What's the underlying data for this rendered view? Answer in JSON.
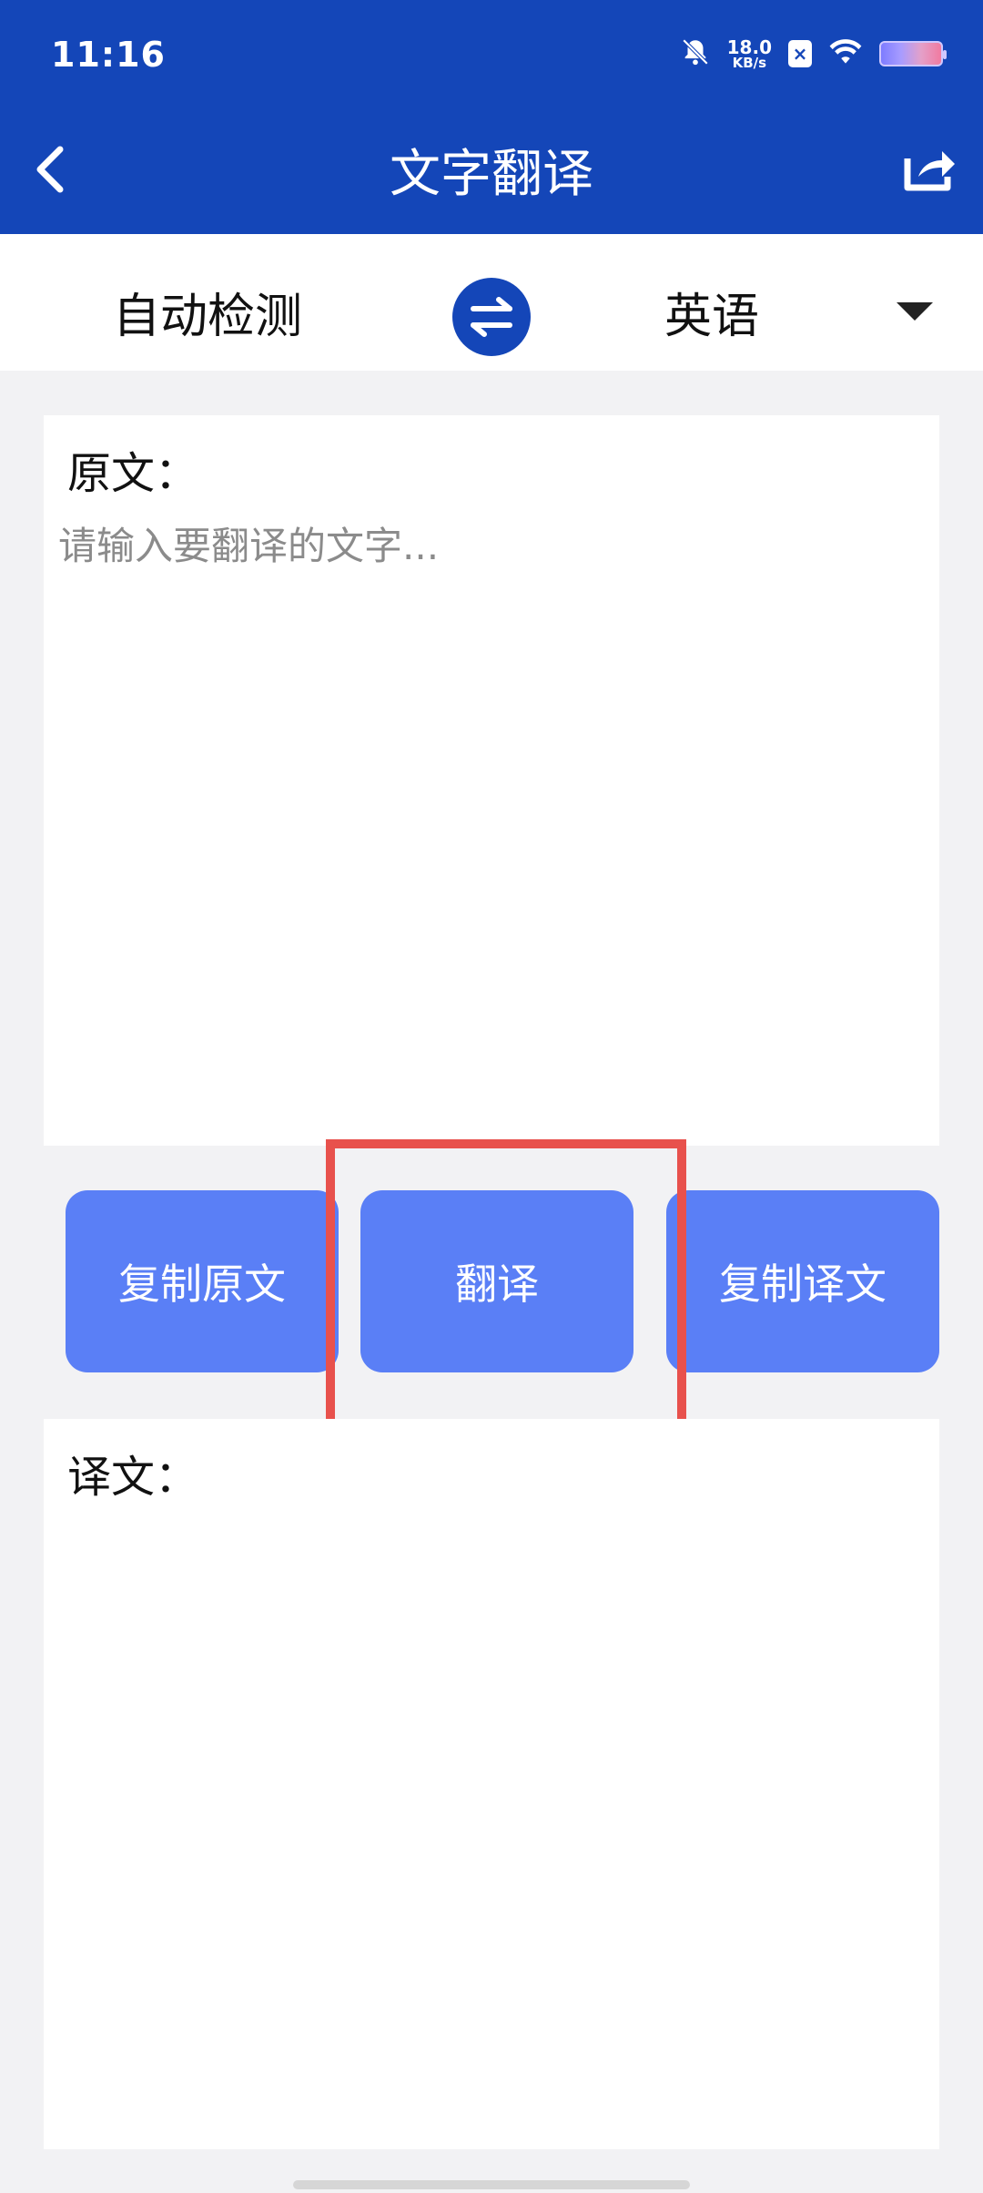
{
  "status_bar": {
    "time": "11:16",
    "net_speed_value": "18.0",
    "net_speed_unit": "KB/s",
    "sim_label": "×"
  },
  "header": {
    "title": "文字翻译"
  },
  "language_bar": {
    "source_language": "自动检测",
    "target_language": "英语"
  },
  "source_panel": {
    "label": "原文：",
    "placeholder": "请输入要翻译的文字...",
    "value": ""
  },
  "buttons": {
    "copy_source": "复制原文",
    "translate": "翻译",
    "copy_target": "复制译文"
  },
  "target_panel": {
    "label": "译文：",
    "value": ""
  },
  "colors": {
    "header_blue": "#1446b8",
    "button_blue": "#5a7ff6",
    "highlight_red": "#e8514c",
    "background": "#f2f2f4"
  }
}
